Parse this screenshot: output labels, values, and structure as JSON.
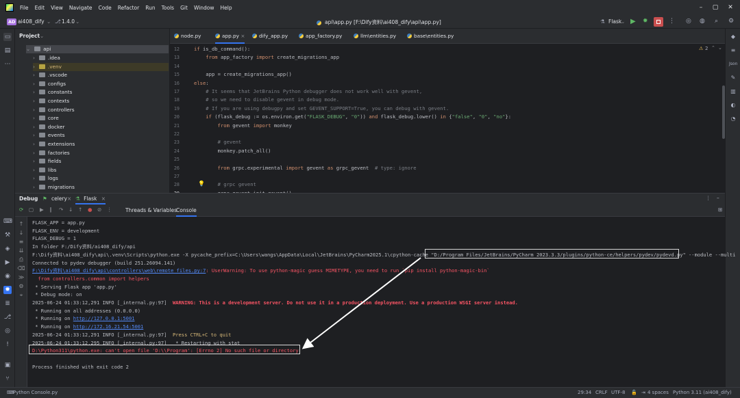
{
  "menu": [
    "File",
    "Edit",
    "View",
    "Navigate",
    "Code",
    "Refactor",
    "Run",
    "Tools",
    "Git",
    "Window",
    "Help"
  ],
  "toolbar": {
    "project_badge": "AD",
    "project_name": "ai408_dify",
    "version": "1.4.0",
    "file_title": "api\\app.py [F:\\Dify资料\\ai408_dify\\api\\app.py]",
    "run_config": "Flask"
  },
  "project": {
    "title": "Project",
    "root": "api",
    "items": [
      ".idea",
      ".venv",
      ".vscode",
      "configs",
      "constants",
      "contexts",
      "controllers",
      "core",
      "docker",
      "events",
      "extensions",
      "factories",
      "fields",
      "libs",
      "logs",
      "migrations"
    ]
  },
  "tabs": [
    "node.py",
    "app.py",
    "dify_app.py",
    "app_factory.py",
    "llm\\entities.py",
    "base\\entities.py"
  ],
  "editor": {
    "warnings": "2",
    "line_numbers": [
      "12",
      "13",
      "14",
      "15",
      "16",
      "17",
      "18",
      "19",
      "20",
      "21",
      "22",
      "23",
      "24",
      "25",
      "26",
      "27",
      "28",
      "29"
    ],
    "lines": [
      {
        "parts": [
          [
            "kw",
            "if "
          ],
          [
            "tx",
            "is_db_command():"
          ]
        ]
      },
      {
        "parts": [
          [
            "kw",
            "    from "
          ],
          [
            "tx",
            "app_factory "
          ],
          [
            "kw",
            "import "
          ],
          [
            "tx",
            "create_migrations_app"
          ]
        ]
      },
      {
        "parts": [
          [
            "tx",
            ""
          ]
        ]
      },
      {
        "parts": [
          [
            "tx",
            "    app = create_migrations_app()"
          ]
        ]
      },
      {
        "parts": [
          [
            "kw",
            "else"
          ],
          [
            "tx",
            ":"
          ]
        ]
      },
      {
        "parts": [
          [
            "cm",
            "    # It seems that JetBrains Python debugger does not work well with gevent,"
          ]
        ]
      },
      {
        "parts": [
          [
            "cm",
            "    # so we need to disable gevent in debug mode."
          ]
        ]
      },
      {
        "parts": [
          [
            "cm",
            "    # If you are using debugpy and set GEVENT_SUPPORT=True, you can debug with gevent."
          ]
        ]
      },
      {
        "parts": [
          [
            "kw",
            "    if "
          ],
          [
            "tx",
            "(flask_debug := os.environ.get("
          ],
          [
            "str",
            "\"FLASK_DEBUG\""
          ],
          [
            "tx",
            ", "
          ],
          [
            "str",
            "\"0\""
          ],
          [
            "tx",
            ")) "
          ],
          [
            "kw",
            "and "
          ],
          [
            "tx",
            "flask_debug.lower() "
          ],
          [
            "kw",
            "in "
          ],
          [
            "tx",
            "{"
          ],
          [
            "str",
            "\"false\""
          ],
          [
            "tx",
            ", "
          ],
          [
            "str",
            "\"0\""
          ],
          [
            "tx",
            ", "
          ],
          [
            "str",
            "\"no\""
          ],
          [
            "tx",
            "}:"
          ]
        ]
      },
      {
        "parts": [
          [
            "kw",
            "        from "
          ],
          [
            "tx",
            "gevent "
          ],
          [
            "kw",
            "import "
          ],
          [
            "tx",
            "monkey"
          ]
        ]
      },
      {
        "parts": [
          [
            "tx",
            ""
          ]
        ]
      },
      {
        "parts": [
          [
            "cm",
            "        # gevent"
          ]
        ]
      },
      {
        "parts": [
          [
            "tx",
            "        monkey.patch_all()"
          ]
        ]
      },
      {
        "parts": [
          [
            "tx",
            ""
          ]
        ]
      },
      {
        "parts": [
          [
            "kw",
            "        from "
          ],
          [
            "tx",
            "grpc.experimental "
          ],
          [
            "kw",
            "import "
          ],
          [
            "tx",
            "gevent "
          ],
          [
            "kw",
            "as "
          ],
          [
            "tx",
            "grpc_gevent  "
          ],
          [
            "cm",
            "# type: ignore"
          ]
        ]
      },
      {
        "parts": [
          [
            "tx",
            ""
          ]
        ]
      },
      {
        "parts": [
          [
            "cm",
            "        # grpc gevent"
          ]
        ]
      },
      {
        "parts": [
          [
            "tx",
            "        grpc_gevent.init_gevent()"
          ]
        ]
      }
    ]
  },
  "debug": {
    "title": "Debug",
    "tabs": [
      "celery",
      "Flask"
    ],
    "subtabs": [
      "Threads & Variables",
      "Console"
    ]
  },
  "console": [
    {
      "cls": "",
      "text": "FLASK_APP = app.py"
    },
    {
      "cls": "",
      "text": "FLASK_ENV = development"
    },
    {
      "cls": "",
      "text": "FLASK_DEBUG = 1"
    },
    {
      "cls": "",
      "text": "In folder F:/Dify资料/ai408_dify/api"
    },
    {
      "cls": "",
      "text": "F:\\Dify资料\\ai408_dify\\api\\.venv\\Scripts\\python.exe -X pycache_prefix=C:\\Users\\wangs\\AppData\\Local\\JetBrains\\PyCharm2025.1\\cpython-cache \"D:/Program Files/JetBrains/PyCharm 2023.3.3/plugins/python-ce/helpers/pydev/pydevd.py\" --module --multi"
    },
    {
      "cls": "",
      "text": "Connected to pydev debugger (build 251.26094.141)"
    },
    {
      "cls": "err",
      "text": "F:\\Dify资料\\ai408_dify\\api\\controllers\\web\\remote_files.py:7: UserWarning: To use python-magic guess MIMETYPE, you need to run `pip install python-magic-bin`"
    },
    {
      "cls": "err",
      "text": "  from controllers.common import helpers"
    },
    {
      "cls": "",
      "text": " * Serving Flask app 'app.py'"
    },
    {
      "cls": "",
      "text": " * Debug mode: on"
    },
    {
      "cls": "",
      "text": "2025-06-24 01:33:12,291 INFO [_internal.py:97]  WARNING: This is a development server. Do not use it in a production deployment. Use a production WSGI server instead."
    },
    {
      "cls": "",
      "text": " * Running on all addresses (0.0.0.0)"
    },
    {
      "cls": "",
      "text": " * Running on http://127.0.0.1:5001"
    },
    {
      "cls": "",
      "text": " * Running on http://172.16.21.54:5001"
    },
    {
      "cls": "",
      "text": "2025-06-24 01:33:12,291 INFO [_internal.py:97]  Press CTRL+C to quit"
    },
    {
      "cls": "",
      "text": "2025-06-24 01:33:12,295 INFO [_internal.py:97]   * Restarting with stat"
    },
    {
      "cls": "err",
      "text": "D:\\Python311\\python.exe: can't open file 'D:\\\\Program': [Errno 2] No such file or directory"
    },
    {
      "cls": "",
      "text": ""
    },
    {
      "cls": "",
      "text": "Process finished with exit code 2"
    }
  ],
  "status": {
    "left": "Python Console.py",
    "pos": "29:34",
    "eol": "CRLF",
    "enc": "UTF-8",
    "indent": "4 spaces",
    "interp": "Python 3.11 (ai408_dify)"
  },
  "icons": {
    "run": "run-icon",
    "debug": "debug-icon",
    "stop": "stop-icon"
  },
  "colors": {
    "accent": "#3574f0",
    "error": "#f75464",
    "badge": "#a772e0"
  }
}
